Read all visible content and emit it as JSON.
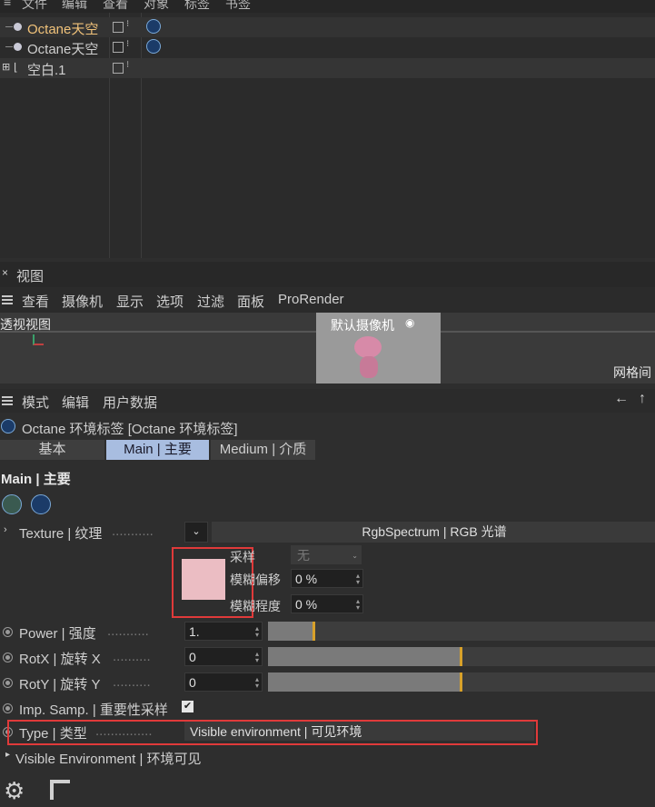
{
  "top_menu": [
    "文件",
    "编辑",
    "查看",
    "对象",
    "标签",
    "书签"
  ],
  "objects": [
    {
      "name": "Octane天空",
      "color": "#f0c27a"
    },
    {
      "name": "Octane天空",
      "color": "#cfcfcf"
    },
    {
      "name": "空白.1",
      "color": "#cfcfcf"
    }
  ],
  "viewport": {
    "panel_title": "视图",
    "menu": [
      "查看",
      "摄像机",
      "显示",
      "选项",
      "过滤",
      "面板",
      "ProRender"
    ],
    "view_name": "透视视图",
    "camera_label": "默认摄像机",
    "grid_label": "网格间"
  },
  "attributes": {
    "menu": [
      "模式",
      "编辑",
      "用户数据"
    ],
    "title": "Octane 环境标签 [Octane 环境标签]",
    "tabs": [
      "基本",
      "Main | 主要",
      "Medium | 介质"
    ],
    "section": "Main | 主要",
    "texture": {
      "label": "Texture | 纹理",
      "dots": "...........",
      "value": "RgbSpectrum | RGB 光谱",
      "swatch_color": "#ebbdc3",
      "sampling_label": "采样",
      "sampling_value": "无",
      "blur_offset_label": "模糊偏移",
      "blur_offset_value": "0 %",
      "blur_scale_label": "模糊程度",
      "blur_scale_value": "0 %"
    },
    "power": {
      "label": "Power | 强度",
      "dots": "...........",
      "value": "1.",
      "level": 0.12
    },
    "rotx": {
      "label": "RotX | 旋转 X",
      "dots": "..........",
      "value": "0",
      "level": 0.5
    },
    "roty": {
      "label": "RotY | 旋转 Y",
      "dots": "..........",
      "value": "0",
      "level": 0.5
    },
    "imp_samp": {
      "label": "Imp. Samp. | 重要性采样",
      "checked": "✔"
    },
    "type": {
      "label": "Type | 类型",
      "dots": "...............",
      "value": "Visible environment | 可见环境"
    },
    "visible_env": {
      "label": "Visible Environment | 环境可见"
    }
  },
  "colors": {
    "accent": "#d8a12a",
    "highlight_tab": "#a8bde0",
    "annotation": "#e03a3a"
  }
}
